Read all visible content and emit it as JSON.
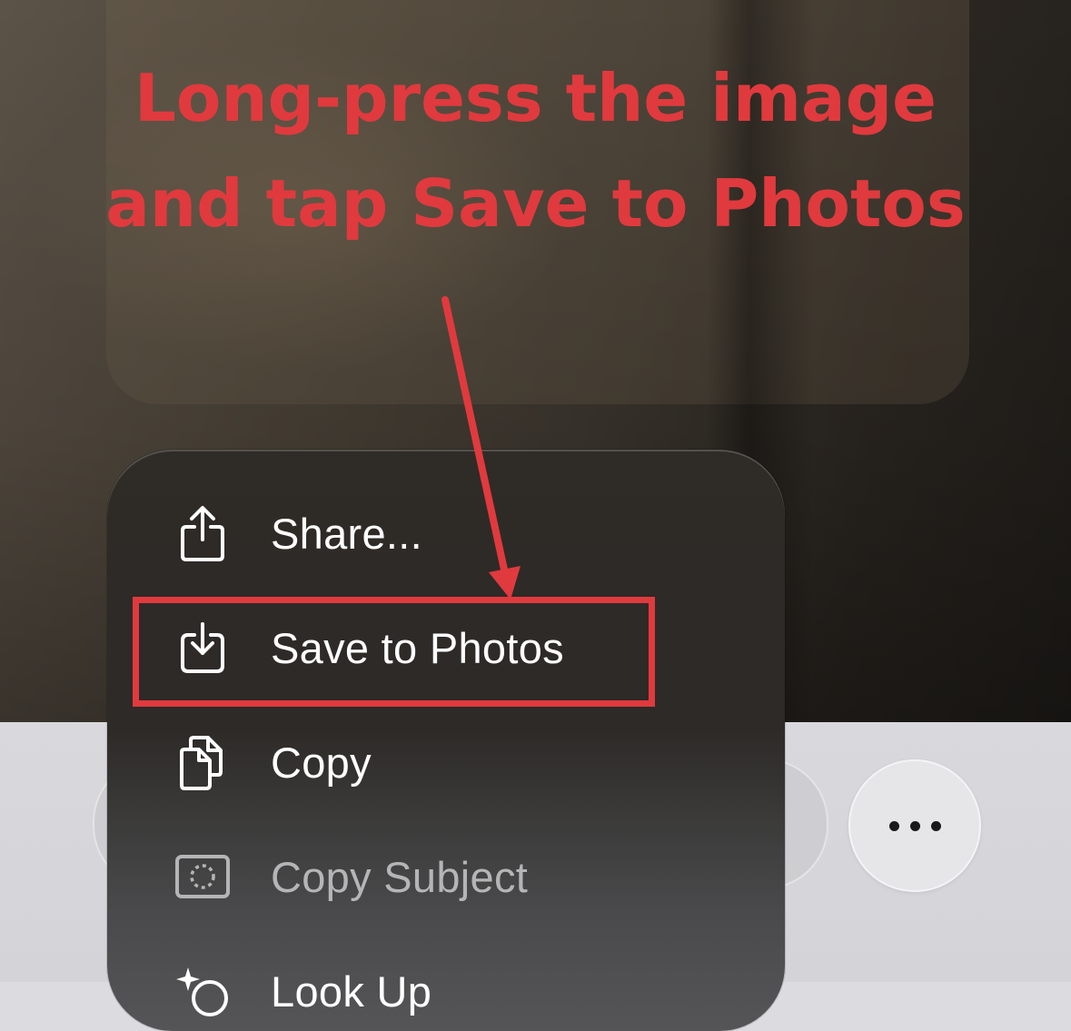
{
  "annotation": {
    "line1": "Long-press the image",
    "line2": "and tap Save to Photos",
    "color": "#e03a3e"
  },
  "context_menu": {
    "items": [
      {
        "label": "Share...",
        "icon": "share-icon",
        "enabled": true
      },
      {
        "label": "Save to Photos",
        "icon": "save-to-photos-icon",
        "enabled": true
      },
      {
        "label": "Copy",
        "icon": "copy-icon",
        "enabled": true
      },
      {
        "label": "Copy Subject",
        "icon": "copy-subject-icon",
        "enabled": false
      },
      {
        "label": "Look Up",
        "icon": "look-up-icon",
        "enabled": true
      }
    ]
  },
  "bottom_bar": {
    "more_button_icon": "ellipsis-icon"
  }
}
